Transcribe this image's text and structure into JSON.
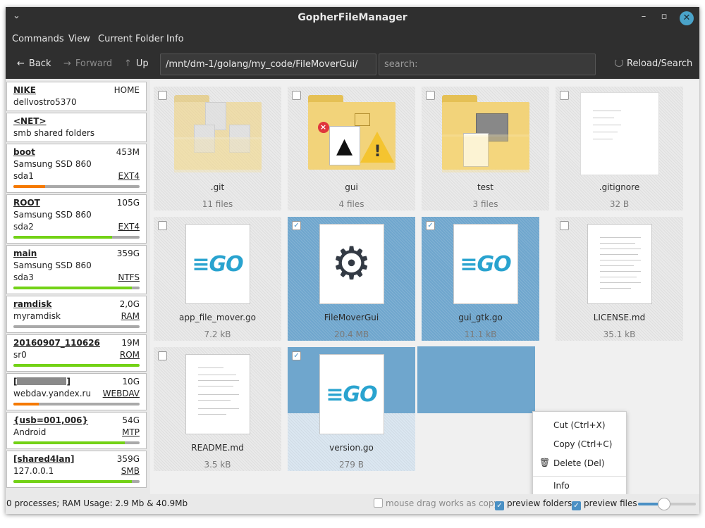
{
  "window": {
    "title": "GopherFileManager",
    "menu_glyph": "⌄",
    "min": "–",
    "restore": "▫",
    "close": "✕"
  },
  "menubar": [
    "Commands",
    "View",
    "Current Folder",
    "Info"
  ],
  "toolbar": {
    "back": "Back",
    "forward": "Forward",
    "up": "Up",
    "path": "/mnt/dm-1/golang/my_code/FileMoverGui/",
    "search_placeholder": "search:",
    "reload": "Reload/Search"
  },
  "sidebar": [
    {
      "name": "NIKE",
      "right": "HOME",
      "line2": "dellvostro5370"
    },
    {
      "name": "<NET>",
      "line2": "smb shared folders"
    },
    {
      "name": "boot",
      "right": "453M",
      "line2": "Samsung SSD 860",
      "dev": "sda1",
      "fs": "EXT4",
      "usage": 0.25,
      "warn": true
    },
    {
      "name": "ROOT",
      "right": "105G",
      "line2": "Samsung SSD 860",
      "dev": "sda2",
      "fs": "EXT4",
      "usage": 0.78,
      "warn": false
    },
    {
      "name": "main",
      "right": "359G",
      "line2": "Samsung SSD 860",
      "dev": "sda3",
      "fs": "NTFS",
      "usage": 0.94,
      "warn": false
    },
    {
      "name": "ramdisk",
      "right": "2,0G",
      "line2": "myramdisk",
      "fs": "RAM",
      "usage": 0.0,
      "warn": false
    },
    {
      "name": "20160907_110626",
      "right": "19M",
      "line2": "sr0",
      "fs": "ROM",
      "usage": 1.0,
      "warn": false
    },
    {
      "name": "[",
      "name_end": "]",
      "right": "10G",
      "line2": "webdav.yandex.ru",
      "fs": "WEBDAV",
      "usage": 0.2,
      "warn": true
    },
    {
      "name": "{usb=001,006}",
      "right": "54G",
      "line2": "Android",
      "fs": "MTP",
      "usage": 0.88,
      "warn": false
    },
    {
      "name": "[shared4lan]",
      "right": "359G",
      "line2": "127.0.0.1",
      "fs": "SMB",
      "usage": 0.94,
      "warn": false
    }
  ],
  "files": [
    {
      "name": ".git",
      "size": "11 files",
      "kind": "folder",
      "selected": false
    },
    {
      "name": "gui",
      "size": "4 files",
      "kind": "folder",
      "selected": false
    },
    {
      "name": "test",
      "size": "3 files",
      "kind": "folder",
      "selected": false
    },
    {
      "name": ".gitignore",
      "size": "32 B",
      "kind": "doc",
      "selected": false
    },
    {
      "name": "app_file_mover.go",
      "size": "7.2 kB",
      "kind": "go",
      "selected": false
    },
    {
      "name": "FileMoverGui",
      "size": "20.4 MB",
      "kind": "exec",
      "selected": true
    },
    {
      "name": "gui_gtk.go",
      "size": "11.1 kB",
      "kind": "go",
      "selected": true
    },
    {
      "name": "LICENSE.md",
      "size": "35.1 kB",
      "kind": "doc",
      "selected": false
    },
    {
      "name": "README.md",
      "size": "3.5 kB",
      "kind": "doc",
      "selected": false
    },
    {
      "name": "version.go",
      "size": "279 B",
      "kind": "go",
      "selected": true
    }
  ],
  "go_logo": "≡GO",
  "context_menu": {
    "cut": "Cut (Ctrl+X)",
    "copy": "Copy (Ctrl+C)",
    "delete": "Delete (Del)",
    "info": "Info"
  },
  "status": {
    "processes": "0 processes; RAM Usage: 2.9 Mb & 40.9Mb",
    "drag_copy": "mouse drag works as copy",
    "preview_folders": "preview folders",
    "preview_files": "preview files",
    "drag_copy_checked": false,
    "preview_folders_checked": true,
    "preview_files_checked": true
  },
  "colors": {
    "selection": "#6fa6cd",
    "go_blue": "#29a3cf",
    "bar_green": "#73d216",
    "bar_orange": "#f57900",
    "titlebar": "#2f2f2f"
  }
}
